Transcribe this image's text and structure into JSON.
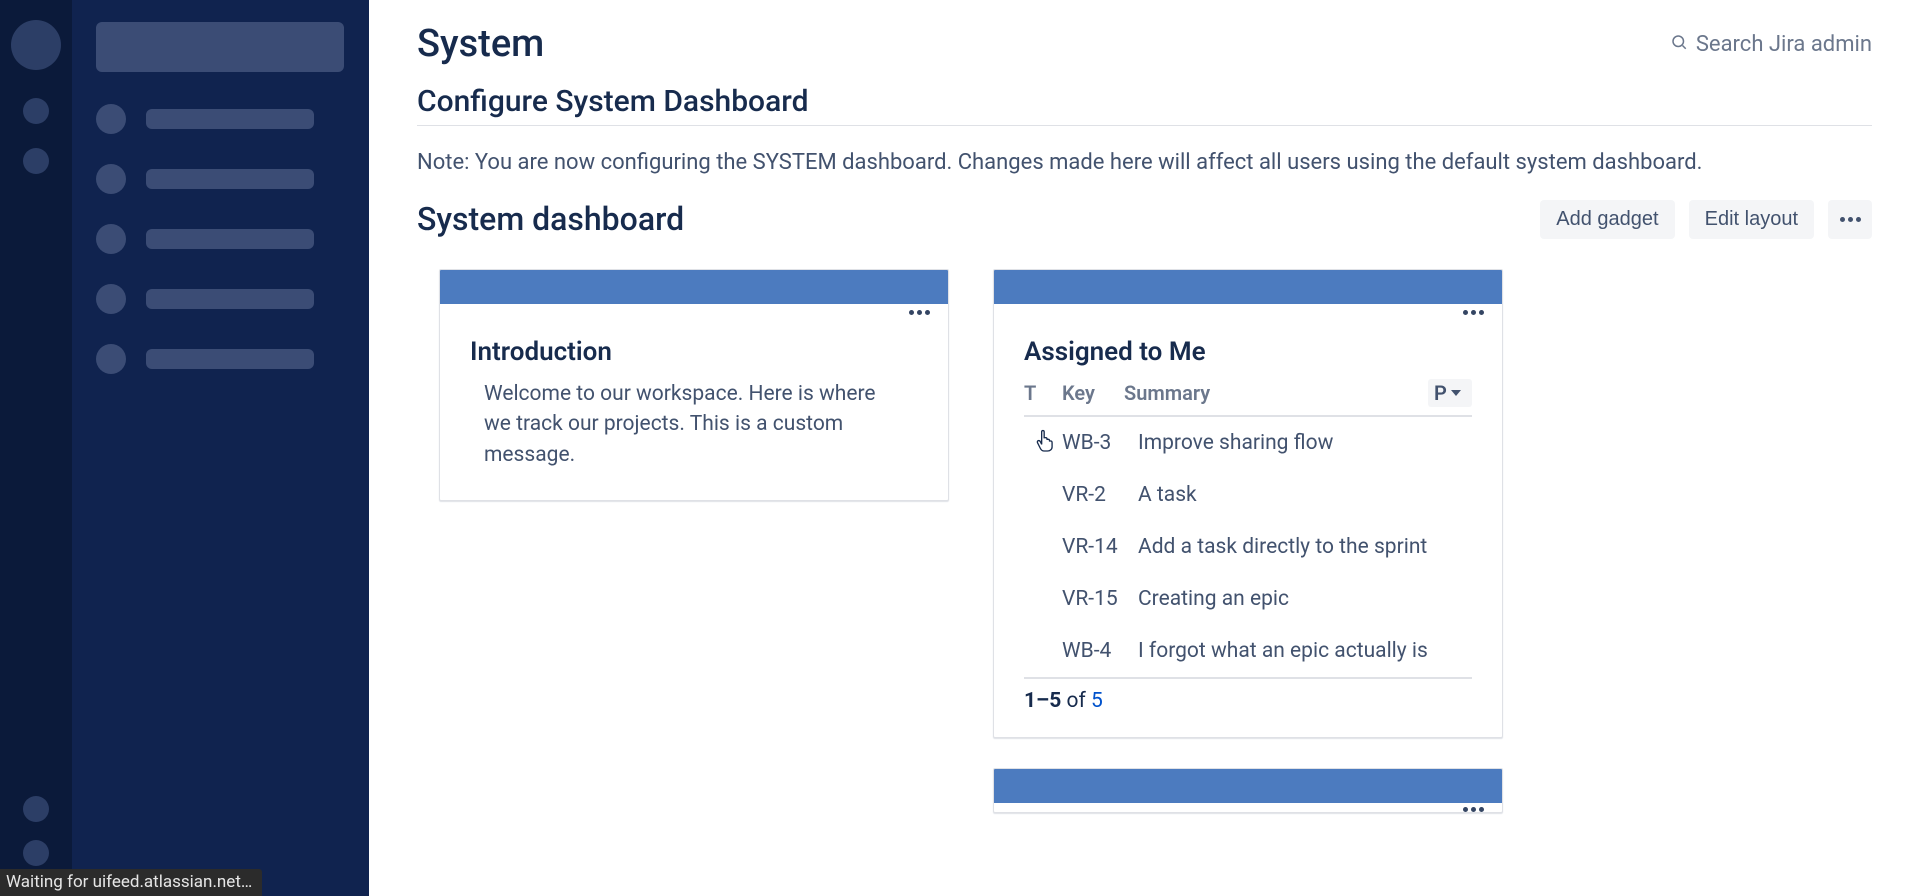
{
  "page": {
    "title": "System",
    "search_placeholder": "Search Jira admin",
    "sub_heading": "Configure System Dashboard",
    "note": "Note: You are now configuring the SYSTEM dashboard. Changes made here will affect all users using the default system dashboard.",
    "dashboard_heading": "System dashboard"
  },
  "actions": {
    "add_gadget": "Add gadget",
    "edit_layout": "Edit layout"
  },
  "gadgets": {
    "intro": {
      "title": "Introduction",
      "body": "Welcome to our workspace. Here is where we track our projects. This is a custom message."
    },
    "assigned": {
      "title": "Assigned to Me",
      "cols": {
        "t": "T",
        "key": "Key",
        "summary": "Summary",
        "p": "P"
      },
      "rows": [
        {
          "key": "WB-3",
          "summary": "Improve sharing flow"
        },
        {
          "key": "VR-2",
          "summary": "A task"
        },
        {
          "key": "VR-14",
          "summary": "Add a task directly to the sprint"
        },
        {
          "key": "VR-15",
          "summary": "Creating an epic"
        },
        {
          "key": "WB-4",
          "summary": "I forgot what an epic actually is"
        }
      ],
      "footer": {
        "range": "1–5",
        "of": " of ",
        "total": "5"
      }
    }
  },
  "status_bar": "Waiting for uifeed.atlassian.net…"
}
